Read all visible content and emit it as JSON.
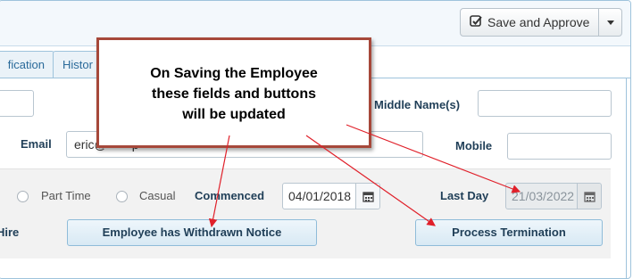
{
  "toolbar": {
    "save_label": "Save and Approve",
    "save_icon": "check-square-icon",
    "caret_icon": "chevron-down-icon"
  },
  "tabs": [
    {
      "label": "fication"
    },
    {
      "label": "Histor"
    }
  ],
  "fields": {
    "middle_name_label": "Middle Name(s)",
    "email_label": "Email",
    "email_value": "eric@",
    "email_value_tail": "p",
    "mobile_label": "Mobile"
  },
  "employment": {
    "part_time_label": "Part Time",
    "casual_label": "Casual",
    "commenced_label": "Commenced",
    "commenced_value": "04/01/2018",
    "last_day_label": "Last Day",
    "last_day_value": "21/03/2022",
    "hire_label": "Hire",
    "withdrawn_button": "Employee has Withdrawn Notice",
    "process_button": "Process Termination"
  },
  "callout": {
    "line1": "On Saving the Employee",
    "line2": "these fields and buttons",
    "line3": "will be updated"
  },
  "colors": {
    "callout_border": "#a6483a",
    "arrow": "#e0202a"
  }
}
